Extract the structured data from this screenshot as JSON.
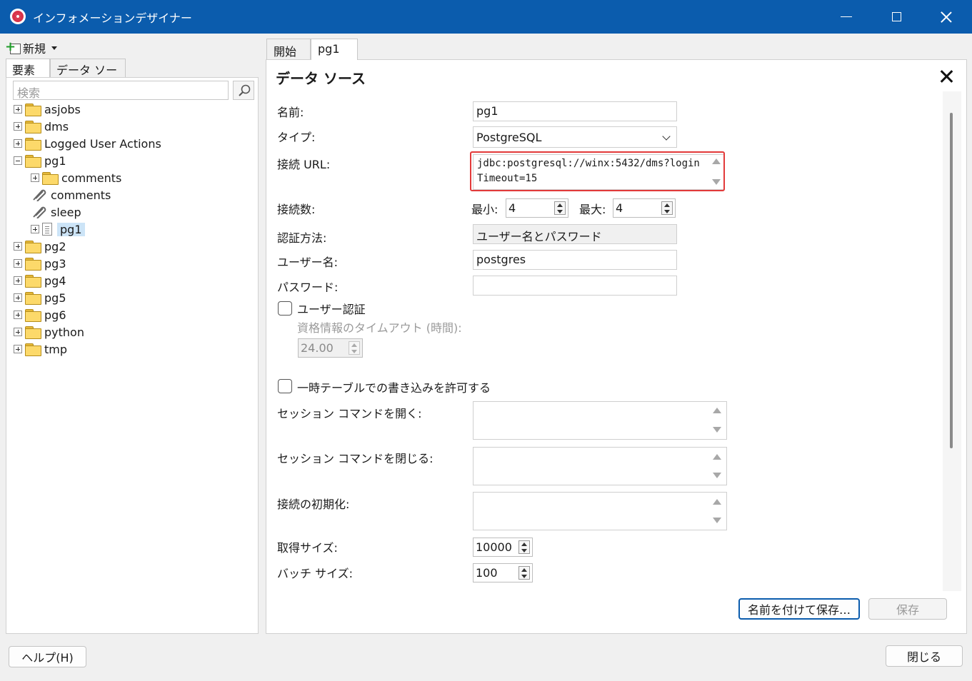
{
  "window": {
    "title": "インフォメーションデザイナー"
  },
  "left": {
    "new_label": "新規",
    "tabs": [
      "要素",
      "データ ソース"
    ],
    "search_placeholder": "検索",
    "tree": [
      {
        "label": "asjobs"
      },
      {
        "label": "dms"
      },
      {
        "label": "Logged User Actions"
      },
      {
        "label": "pg1"
      },
      {
        "label": "comments"
      },
      {
        "label": "comments"
      },
      {
        "label": "sleep"
      },
      {
        "label": "pg1"
      },
      {
        "label": "pg2"
      },
      {
        "label": "pg3"
      },
      {
        "label": "pg4"
      },
      {
        "label": "pg5"
      },
      {
        "label": "pg6"
      },
      {
        "label": "python"
      },
      {
        "label": "tmp"
      }
    ]
  },
  "right": {
    "tabs": [
      "開始",
      "pg1"
    ],
    "heading": "データ ソース",
    "fields": {
      "name_label": "名前:",
      "name_value": "pg1",
      "type_label": "タイプ:",
      "type_value": "PostgreSQL",
      "url_label": "接続 URL:",
      "url_value": "jdbc:postgresql://winx:5432/dms?loginTimeout=15",
      "conn_label": "接続数:",
      "min_label": "最小:",
      "min_value": "4",
      "max_label": "最大:",
      "max_value": "4",
      "auth_label": "認証方法:",
      "auth_value": "ユーザー名とパスワード",
      "user_label": "ユーザー名:",
      "user_value": "postgres",
      "password_label": "パスワード:",
      "user_auth_label": "ユーザー認証",
      "cred_timeout_label": "資格情報のタイムアウト (時間):",
      "cred_timeout_value": "24.00",
      "temp_table_label": "一時テーブルでの書き込みを許可する",
      "open_session_label": "セッション コマンドを開く:",
      "close_session_label": "セッション コマンドを閉じる:",
      "init_label": "接続の初期化:",
      "fetch_label": "取得サイズ:",
      "fetch_value": "10000",
      "batch_label": "バッチ サイズ:",
      "batch_value": "100"
    },
    "save_as_label": "名前を付けて保存…",
    "save_label": "保存"
  },
  "footer": {
    "help_label": "ヘルプ(H)",
    "close_label": "閉じる"
  }
}
